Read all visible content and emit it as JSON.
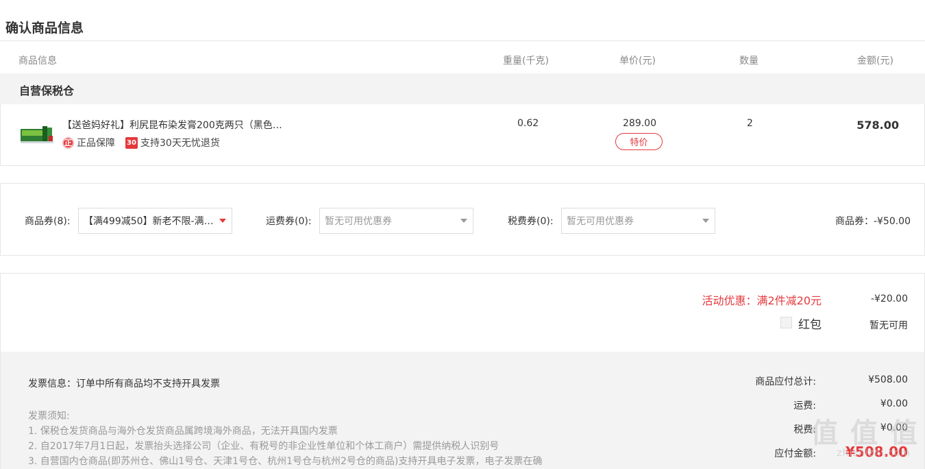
{
  "page": {
    "title": "确认商品信息"
  },
  "columns": {
    "info": "商品信息",
    "weight": "重量(千克)",
    "price": "单价(元)",
    "qty": "数量",
    "amount": "金额(元)"
  },
  "warehouse": {
    "name": "自营保税仓"
  },
  "product": {
    "title": "【送爸妈好礼】利尻昆布染发膏200克两只（黑色…",
    "badge_genuine_icon": "正",
    "badge_genuine": "正品保障",
    "badge_return_icon": "30",
    "badge_return": "支持30天无忧退货",
    "weight": "0.62",
    "price": "289.00",
    "price_tag": "特价",
    "qty": "2",
    "amount": "578.00"
  },
  "coupons": {
    "goods_label": "商品券(8):",
    "goods_selected": "【满499减50】新老不限-满…",
    "shipping_label": "运费券(0):",
    "shipping_selected": "暂无可用优惠券",
    "tax_label": "税费券(0):",
    "tax_selected": "暂无可用优惠券",
    "goods_discount": "商品券：-¥50.00"
  },
  "promotion": {
    "text": "活动优惠：满2件减20元",
    "value": "-¥20.00",
    "redpack_label": "红包",
    "redpack_value": "暂无可用"
  },
  "invoice": {
    "info": "发票信息：订单中所有商品均不支持开具发票",
    "notice_title": "发票须知:",
    "notices": [
      "1. 保税仓发货商品与海外仓发货商品属跨境海外商品，无法开具国内发票",
      "2. 自2017年7月1日起，发票抬头选择公司（企业、有税号的非企业性单位和个体工商户）需提供纳税人识别号",
      "3. 自营国内仓商品(即苏州仓、佛山1号仓、天津1号仓、杭州1号仓与杭州2号仓的商品)支持开具电子发票，电子发票在确"
    ]
  },
  "summary": {
    "subtotal_label": "商品应付总计:",
    "subtotal": "¥508.00",
    "shipping_label": "运费:",
    "shipping": "¥0.00",
    "tax_label": "税费:",
    "tax": "¥0.00",
    "total_label": "应付金额:",
    "total": "¥508.00"
  },
  "watermark": {
    "main": "值 值 值",
    "sub": "zhizhizhi.com"
  }
}
